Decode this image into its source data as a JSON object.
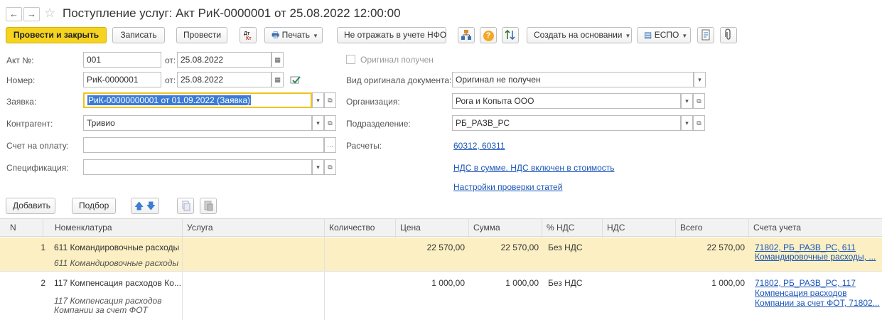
{
  "window": {
    "title": "Поступление услуг: Акт РиК-0000001 от 25.08.2022 12:00:00"
  },
  "toolbar": {
    "post_close": "Провести и закрыть",
    "write": "Записать",
    "post": "Провести",
    "print": "Печать",
    "no_nfo": "Не отражать в учете НФО",
    "create_based": "Создать на основании",
    "espo": "ЕСПО",
    "question": "?"
  },
  "form": {
    "act_label": "Акт №:",
    "act_value": "001",
    "from_label": "от:",
    "act_date": "25.08.2022",
    "number_label": "Номер:",
    "number_value": "РиК-0000001",
    "number_date": "25.08.2022",
    "request_label": "Заявка:",
    "request_value": "РиК-00000000001 от 01.09.2022 (Заявка)",
    "contractor_label": "Контрагент:",
    "contractor_value": "Тривио",
    "invoice_label": "Счет на оплату:",
    "invoice_value": "",
    "spec_label": "Спецификация:",
    "spec_value": "",
    "original_received": "Оригинал получен",
    "original_kind_label": "Вид оригинала документа:",
    "original_kind_value": "Оригинал не получен",
    "org_label": "Организация:",
    "org_value": "Рога и Копыта ООО",
    "dept_label": "Подразделение:",
    "dept_value": "РБ_РАЗВ_РС",
    "calc_label": "Расчеты:",
    "calc_link": "60312, 60311",
    "vat_link": "НДС в сумме. НДС включен в стоимость",
    "check_link": "Настройки проверки статей"
  },
  "table_toolbar": {
    "add": "Добавить",
    "pick": "Подбор"
  },
  "table": {
    "columns": [
      "N",
      "Номенклатура",
      "Услуга",
      "Количество",
      "Цена",
      "Сумма",
      "% НДС",
      "НДС",
      "Всего",
      "Счета учета"
    ],
    "rows": [
      {
        "n": "1",
        "item": "611 Командировочные расходы",
        "item_sub": "611 Командировочные расходы",
        "price": "22 570,00",
        "sum": "22 570,00",
        "vat_rate": "Без НДС",
        "total": "22 570,00",
        "accounts_1": "71802, РБ_РАЗВ_РС, 611",
        "accounts_2": "Командировочные расходы, ..."
      },
      {
        "n": "2",
        "item": "117 Компенсация расходов Ко...",
        "item_sub_1": "117 Компенсация расходов",
        "item_sub_2": "Компании за счет ФОТ",
        "price": "1 000,00",
        "sum": "1 000,00",
        "vat_rate": "Без НДС",
        "total": "1 000,00",
        "accounts_1": "71802, РБ_РАЗВ_РС, 117",
        "accounts_2": "Компенсация расходов",
        "accounts_3": "Компании за счет ФОТ, 71802..."
      }
    ]
  }
}
